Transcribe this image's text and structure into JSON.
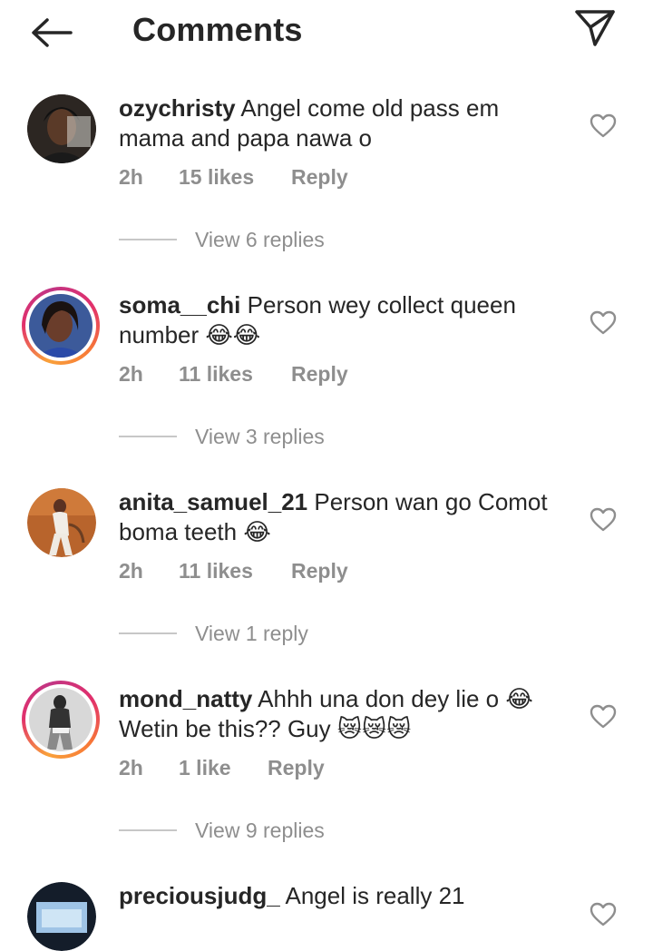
{
  "header": {
    "title": "Comments",
    "back_icon": "arrow-left-icon",
    "send_icon": "paper-plane-icon"
  },
  "comments": [
    {
      "username": "ozychristy",
      "text_line1": "Angel come old pass em",
      "text_line2": "mama and papa nawa o",
      "time": "2h",
      "likes": "15 likes",
      "reply": "Reply",
      "view_replies": "View 6 replies",
      "story_ring": false
    },
    {
      "username": "soma__chi",
      "text_line1": "Person wey collect queen",
      "text_line2": "number 😂😂",
      "time": "2h",
      "likes": "11 likes",
      "reply": "Reply",
      "view_replies": "View 3 replies",
      "story_ring": true
    },
    {
      "username": "anita_samuel_21",
      "text_line1": "Person wan go Comot",
      "text_line2": "boma teeth 😂",
      "time": "2h",
      "likes": "11 likes",
      "reply": "Reply",
      "view_replies": "View 1 reply",
      "story_ring": false
    },
    {
      "username": "mond_natty",
      "text_line1": "Ahhh una don dey lie o 😂",
      "text_line2": "Wetin be this?? Guy 😿😿😿",
      "time": "2h",
      "likes": "1 like",
      "reply": "Reply",
      "view_replies": "View 9 replies",
      "story_ring": true
    },
    {
      "username": "preciousjudg_",
      "text_line1": "Angel is really 21",
      "text_line2": "",
      "story_ring": false
    }
  ],
  "colors": {
    "text_primary": "#262626",
    "text_secondary": "#8e8e8e",
    "divider": "#c7c7c7",
    "story_ring_start": "#f9a13a",
    "story_ring_end": "#c13584"
  }
}
